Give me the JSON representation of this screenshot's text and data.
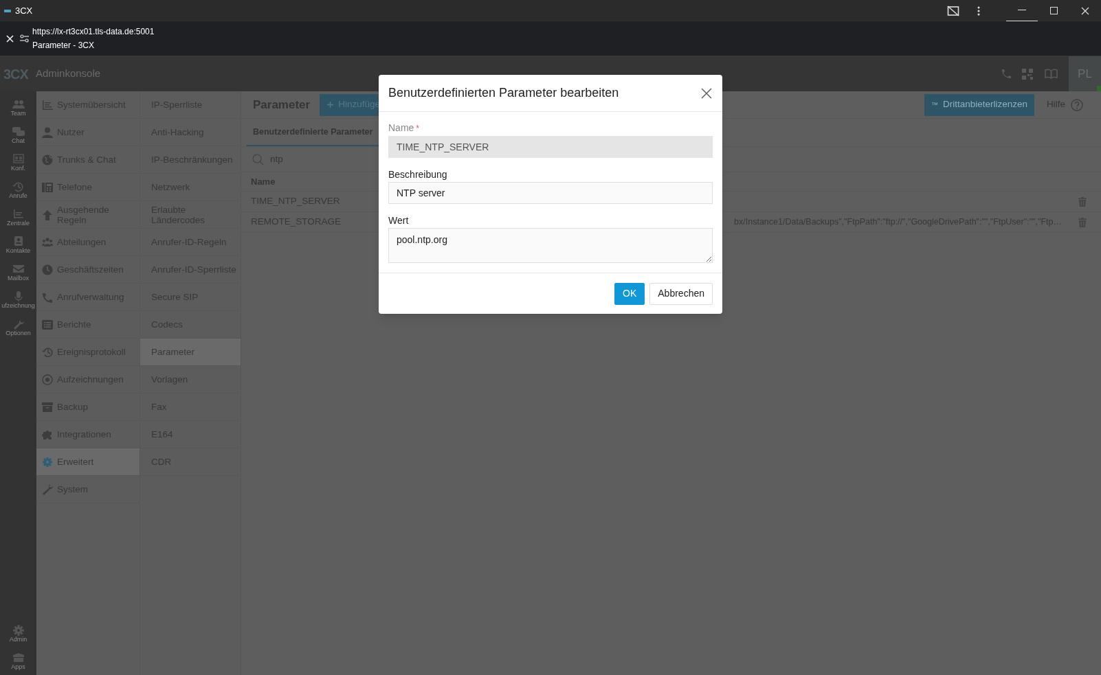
{
  "window": {
    "title": "3CX"
  },
  "browser": {
    "url": "https://lx-rt3cx01.tls-data.de:5001",
    "page_title": "Parameter - 3CX"
  },
  "app": {
    "logo": "3CX",
    "title": "Adminkonsole",
    "avatar": "PL"
  },
  "rail": {
    "items": [
      {
        "label": "Team"
      },
      {
        "label": "Chat"
      },
      {
        "label": "Konf."
      },
      {
        "label": "Anrufe"
      },
      {
        "label": "Zentrale"
      },
      {
        "label": "Kontakte"
      },
      {
        "label": "Mailbox"
      },
      {
        "label": "ufzeichnung"
      },
      {
        "label": "Optionen"
      }
    ],
    "bottom_items": [
      {
        "label": "Admin"
      },
      {
        "label": "Apps"
      }
    ]
  },
  "menu": {
    "items": [
      {
        "label": "Systemübersicht",
        "selected": false
      },
      {
        "label": "Nutzer",
        "selected": false
      },
      {
        "label": "Trunks & Chat",
        "selected": false
      },
      {
        "label": "Telefone",
        "selected": false
      },
      {
        "label": "Ausgehende Regeln",
        "selected": false
      },
      {
        "label": "Abteilungen",
        "selected": false
      },
      {
        "label": "Geschäftszeiten",
        "selected": false
      },
      {
        "label": "Anrufverwaltung",
        "selected": false
      },
      {
        "label": "Berichte",
        "selected": false
      },
      {
        "label": "Ereignisprotokoll",
        "selected": false
      },
      {
        "label": "Aufzeichnungen",
        "selected": false
      },
      {
        "label": "Backup",
        "selected": false
      },
      {
        "label": "Integrationen",
        "selected": false
      },
      {
        "label": "Erweitert",
        "selected": true
      },
      {
        "label": "System",
        "selected": false
      }
    ]
  },
  "submenu": {
    "items": [
      {
        "label": "IP-Sperrliste",
        "selected": false
      },
      {
        "label": "Anti-Hacking",
        "selected": false
      },
      {
        "label": "IP-Beschränkungen",
        "selected": false
      },
      {
        "label": "Netzwerk",
        "selected": false
      },
      {
        "label": "Erlaubte Ländercodes",
        "selected": false
      },
      {
        "label": "Anrufer-ID-Regeln",
        "selected": false
      },
      {
        "label": "Anrufer-ID-Sperrliste",
        "selected": false
      },
      {
        "label": "Secure SIP",
        "selected": false
      },
      {
        "label": "Codecs",
        "selected": false
      },
      {
        "label": "Parameter",
        "selected": true
      },
      {
        "label": "Vorlagen",
        "selected": false
      },
      {
        "label": "Fax",
        "selected": false
      },
      {
        "label": "E164",
        "selected": false
      },
      {
        "label": "CDR",
        "selected": false
      }
    ]
  },
  "page": {
    "title": "Parameter",
    "add_button": "Hinzufüge",
    "license_button": {
      "badge": "™",
      "label": "Drittanbieterlizenzen"
    },
    "help": "Hilfe",
    "tabs": [
      {
        "label": "Benutzerdefinierte Parameter",
        "selected": true
      }
    ],
    "search": {
      "value": "ntp"
    },
    "table": {
      "columns": [
        "Name"
      ],
      "rows": [
        {
          "name": "TIME_NTP_SERVER"
        },
        {
          "name": "REMOTE_STORAGE",
          "value": "bx/Instance1/Data/Backups\",\"FtpPath\":\"ftp://\",\"GoogleDrivePath\":\"\",\"FtpUser\":\"\",\"Ftp…"
        }
      ]
    }
  },
  "dialog": {
    "title": "Benutzerdefinierten Parameter bearbeiten",
    "fields": [
      {
        "kind": "input",
        "label": "Name",
        "required_mark": "*",
        "disabled": true,
        "value": "TIME_NTP_SERVER"
      },
      {
        "kind": "input",
        "label": "Beschreibung",
        "disabled": false,
        "value": "NTP server"
      },
      {
        "kind": "textarea",
        "label": "Wert",
        "disabled": false,
        "value": "pool.ntp.org"
      }
    ],
    "buttons": [
      {
        "label": "OK",
        "primary": true
      },
      {
        "label": "Abbrechen",
        "primary": false
      }
    ]
  }
}
